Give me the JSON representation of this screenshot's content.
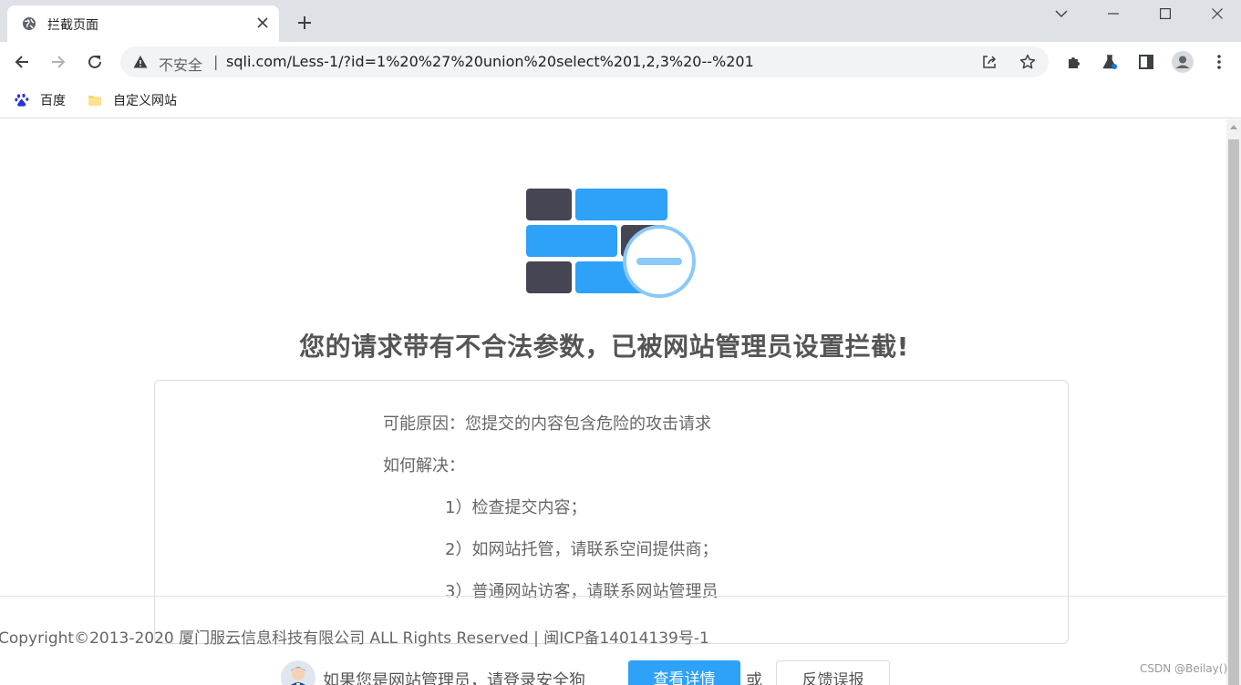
{
  "browser": {
    "tab_title": "拦截页面",
    "omnibox": {
      "security_label": "不安全",
      "separator": "|",
      "url": "sqli.com/Less-1/?id=1%20%27%20union%20select%201,2,3%20--%201"
    },
    "bookmarks": [
      {
        "label": "百度",
        "icon": "baidu-paw-icon"
      },
      {
        "label": "自定义网站",
        "icon": "folder-icon"
      }
    ]
  },
  "page": {
    "headline": "您的请求带有不合法参数，已被网站管理员设置拦截!",
    "reason_line": "可能原因：您提交的内容包含危险的攻击请求",
    "solve_label": "如何解决：",
    "steps": [
      "1）检查提交内容；",
      "2）如网站托管，请联系空间提供商；",
      "3）普通网站访客，请联系网站管理员"
    ],
    "copyright": "Copyright©2013-2020 厦门服云信息科技有限公司 ALL Rights Reserved | 闽ICP备14014139号-1",
    "admin_prompt": "如果您是网站管理员，请登录安全狗",
    "view_details": "查看详情",
    "or_text": "或",
    "report_false_positive": "反馈误报"
  },
  "watermark": "CSDN @Beilay()",
  "colors": {
    "brick_blue": "#2ea1f8",
    "brick_dark": "#464553",
    "badge_ring": "#8ac8f8"
  }
}
